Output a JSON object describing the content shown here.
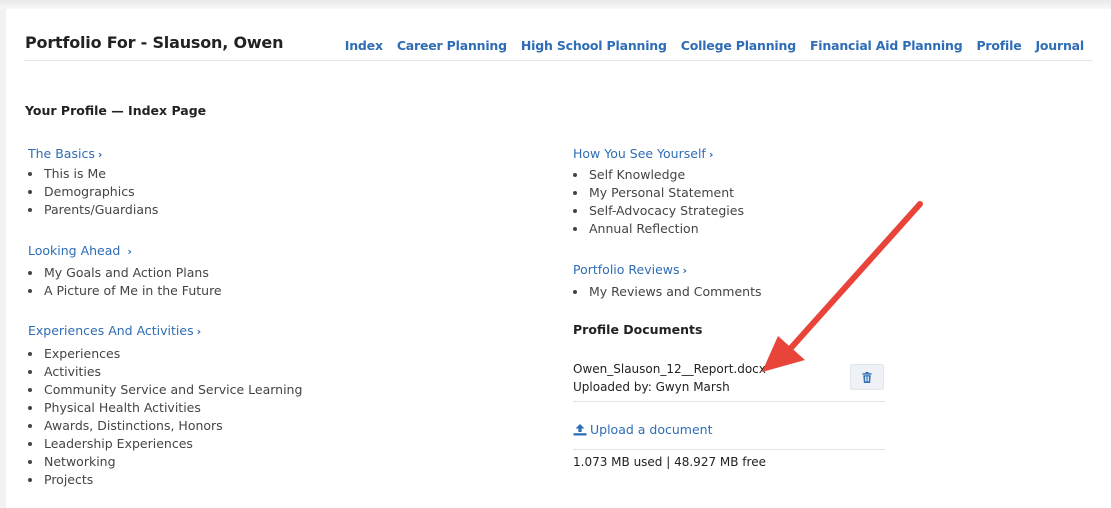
{
  "header": {
    "title": "Portfolio For - Slauson, Owen",
    "nav": [
      "Index",
      "Career Planning",
      "High School Planning",
      "College Planning",
      "Financial Aid Planning",
      "Profile",
      "Journal"
    ]
  },
  "page_heading": "Your Profile — Index Page",
  "left_sections": [
    {
      "title": "The Basics",
      "items": [
        "This is Me",
        "Demographics",
        "Parents/Guardians"
      ]
    },
    {
      "title": "Looking Ahead",
      "items": [
        "My Goals and Action Plans",
        "A Picture of Me in the Future"
      ]
    },
    {
      "title": "Experiences And Activities",
      "items": [
        "Experiences",
        "Activities",
        "Community Service and Service Learning",
        "Physical Health Activities",
        "Awards, Distinctions, Honors",
        "Leadership Experiences",
        "Networking",
        "Projects"
      ]
    }
  ],
  "right_sections": [
    {
      "title": "How You See Yourself",
      "items": [
        "Self Knowledge",
        "My Personal Statement",
        "Self-Advocacy Strategies",
        "Annual Reflection"
      ]
    },
    {
      "title": "Portfolio Reviews",
      "items": [
        "My Reviews and Comments"
      ]
    }
  ],
  "documents": {
    "heading": "Profile Documents",
    "file_name": "Owen_Slauson_12__Report.docx",
    "uploaded_by": "Uploaded by: Gwyn Marsh",
    "upload_label": "Upload a document",
    "usage": "1.073 MB used | 48.927 MB free"
  },
  "colors": {
    "link": "#2f6db5",
    "annotation_arrow": "#e8443a"
  },
  "icons": {
    "chevron": "chevron-right-icon",
    "delete": "trash-icon",
    "upload": "upload-icon"
  }
}
